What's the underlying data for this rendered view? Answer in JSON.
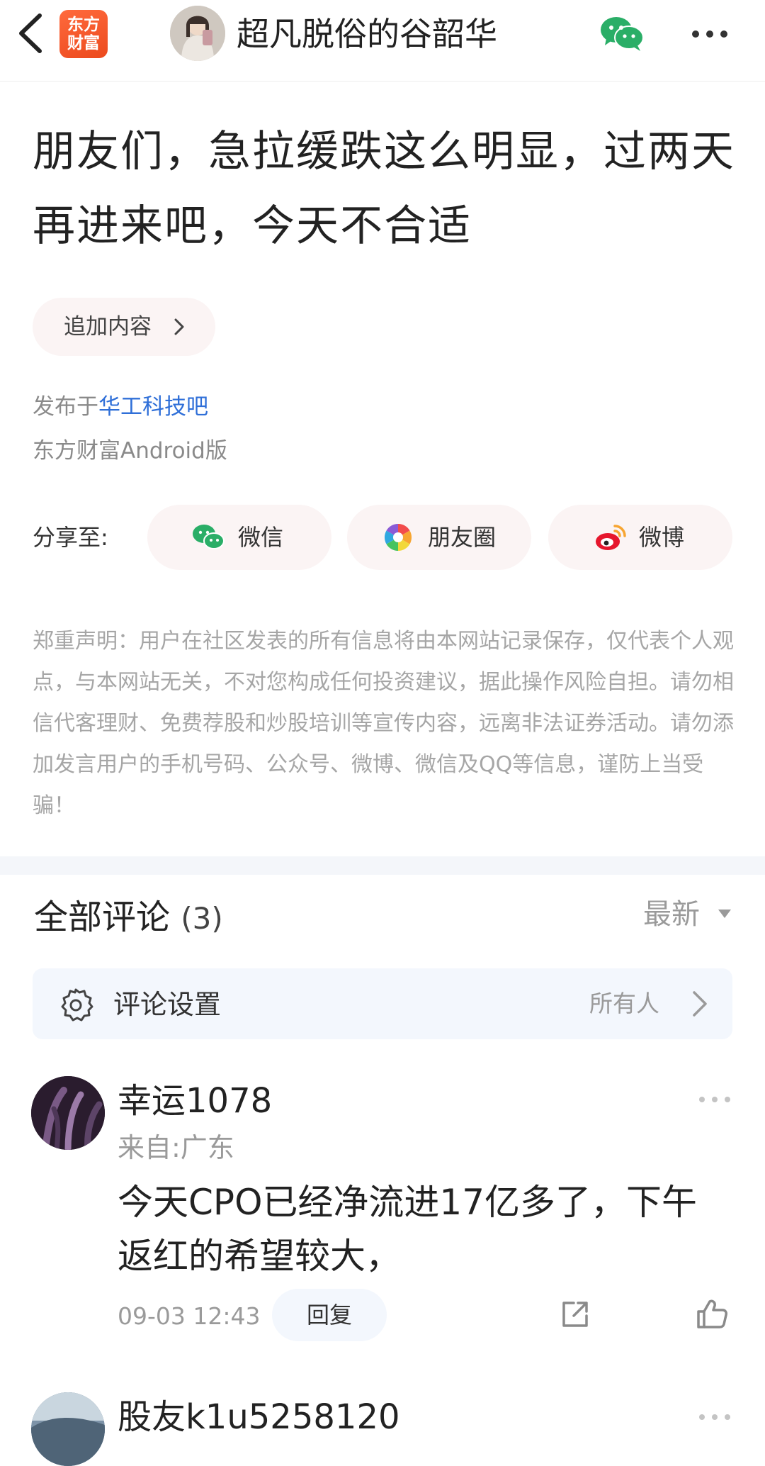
{
  "header": {
    "back_icon": "chevron-left-icon",
    "app_logo_line1": "东方",
    "app_logo_line2": "财富",
    "author_name": "超凡脱俗的谷韶华",
    "wechat_icon": "wechat-icon",
    "more_icon": "more-horizontal-icon"
  },
  "post": {
    "title": "朋友们，急拉缓跌这么明显，过两天再进来吧，今天不合适",
    "append_label": "追加内容",
    "published_prefix": "发布于",
    "forum_link": "华工科技吧",
    "client": "东方财富Android版"
  },
  "share": {
    "label": "分享至:",
    "wechat": "微信",
    "moments": "朋友圈",
    "weibo": "微博"
  },
  "disclaimer": "郑重声明：用户在社区发表的所有信息将由本网站记录保存，仅代表个人观点，与本网站无关，不对您构成任何投资建议，据此操作风险自担。请勿相信代客理财、免费荐股和炒股培训等宣传内容，远离非法证券活动。请勿添加发言用户的手机号码、公众号、微博、微信及QQ等信息，谨防上当受骗！",
  "comments": {
    "title": "全部评论",
    "count": "(3)",
    "sort": "最新",
    "settings_label": "评论设置",
    "settings_value": "所有人",
    "items": [
      {
        "user": "幸运1078",
        "location": "来自:广东",
        "text": "今天CPO已经净流进17亿多了，下午返红的希望较大，",
        "time": "09-03 12:43",
        "reply": "回复"
      },
      {
        "user": "股友k1u5258120"
      }
    ]
  },
  "colors": {
    "accent": "#2f6fd8",
    "logo": "#ec4a1d",
    "wechat_green": "#2aae67",
    "weibo_red": "#e6162d"
  }
}
